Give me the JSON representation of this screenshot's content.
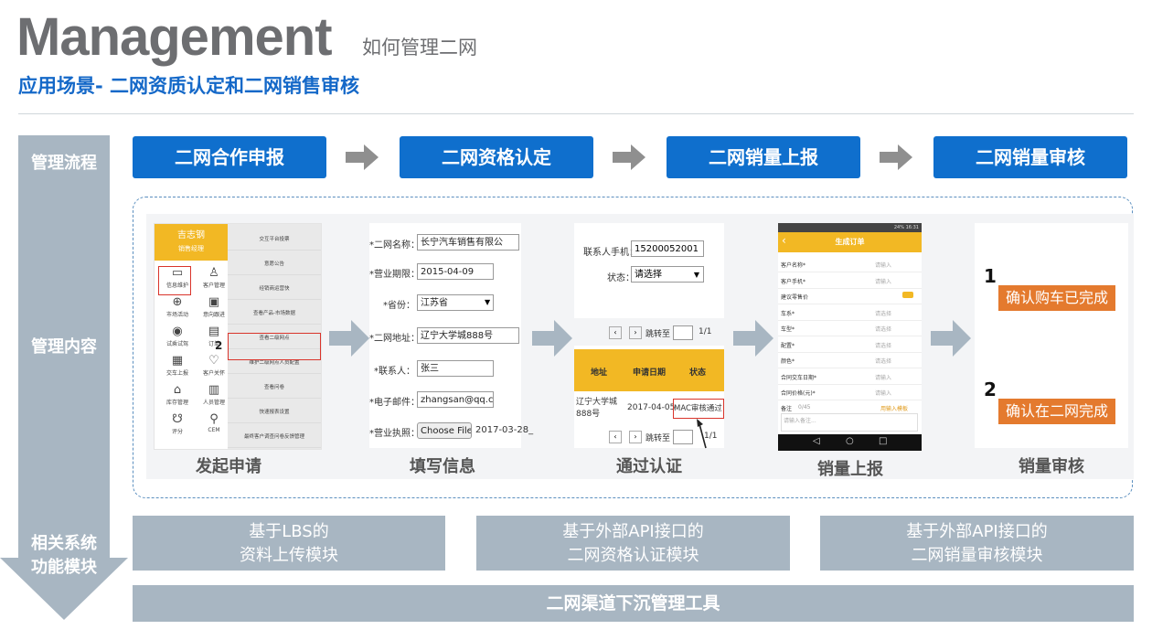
{
  "header": {
    "title": "Management",
    "title_sub": "如何管理二网",
    "subtitle": "应用场景- 二网资质认定和二网销售审核"
  },
  "left_labels": {
    "process": "管理流程",
    "content": "管理内容",
    "system": "相关系统\n功能模块"
  },
  "steps": [
    "二网合作申报",
    "二网资格认定",
    "二网销量上报",
    "二网销量审核"
  ],
  "captions": [
    "发起申请",
    "填写信息",
    "通过认证",
    "销量上报",
    "销量审核"
  ],
  "panel1": {
    "user_name": "吉志钢",
    "user_role": "销售经理",
    "marker": "2",
    "grid": [
      {
        "icon": "monitor-icon",
        "glyph": "▭",
        "label": "信息维护"
      },
      {
        "icon": "user-icon",
        "glyph": "♙",
        "label": "客户管理"
      },
      {
        "icon": "globe-icon",
        "glyph": "⊕",
        "label": "市场活动"
      },
      {
        "icon": "card-icon",
        "glyph": "▣",
        "label": "意向跟进"
      },
      {
        "icon": "car-icon",
        "glyph": "◉",
        "label": "试乘试驾"
      },
      {
        "icon": "order-icon",
        "glyph": "▤",
        "label": "订单"
      },
      {
        "icon": "delivery-icon",
        "glyph": "▦",
        "label": "交车上报"
      },
      {
        "icon": "heart-icon",
        "glyph": "♡",
        "label": "客户关怀"
      },
      {
        "icon": "warehouse-icon",
        "glyph": "⌂",
        "label": "库存管理"
      },
      {
        "icon": "staff-icon",
        "glyph": "▥",
        "label": "人员管理"
      },
      {
        "icon": "rating-icon",
        "glyph": "☋",
        "label": "评分"
      },
      {
        "icon": "cem-icon",
        "glyph": "⚲",
        "label": "CEM"
      }
    ],
    "menu": [
      "交互平台投票",
      "意愿公告",
      "经销商运营快",
      "查看产品-市场数据",
      "查看二级网点",
      "维护二级网点人员配置",
      "查看问卷",
      "快速报表设置",
      "最终客户调查问卷反馈管理"
    ]
  },
  "panel2": {
    "fields": [
      {
        "label": "*二网名称：",
        "value": "长宁汽车销售有限公"
      },
      {
        "label": "*营业期限：",
        "value": "2015-04-09"
      },
      {
        "label": "*省份：",
        "value": "江苏省"
      },
      {
        "label": "*二网地址：",
        "value": "辽宁大学城888号"
      },
      {
        "label": "*联系人：",
        "value": "张三"
      },
      {
        "label": "*电子邮件：",
        "value": "zhangsan@qq.com"
      },
      {
        "label": "*营业执照：",
        "value": "Choose File",
        "extra": "2017-03-28_"
      }
    ]
  },
  "panel3": {
    "phone_label": "联系人手机：",
    "phone_value": "15200052001",
    "status_label": "状态：",
    "status_value": "请选择",
    "pager_label": "跳转至",
    "pager_total": "1/1",
    "col_address": "地址",
    "col_date": "申请日期",
    "col_status": "状态",
    "row_address": "辽宁大学城888号",
    "row_date": "2017-04-05",
    "row_status": "MAC审核通过"
  },
  "panel4": {
    "status_bar": "24%  16:31",
    "title": "生成订单",
    "back": "‹",
    "rows": [
      {
        "label": "客户名称*",
        "value": "请输入"
      },
      {
        "label": "客户手机*",
        "value": "请输入"
      },
      {
        "label": "建议零售价",
        "value": ""
      },
      {
        "label": "车系*",
        "value": "请选择"
      },
      {
        "label": "车型*",
        "value": "请选择"
      },
      {
        "label": "配置*",
        "value": "请选择"
      },
      {
        "label": "颜色*",
        "value": "请选择"
      },
      {
        "label": "合同交车日期*",
        "value": "请输入"
      },
      {
        "label": "合同价格(元)*",
        "value": "请输入"
      }
    ],
    "remark_label": "备注",
    "remark_count": "0/45",
    "remark_template": "用输入模板",
    "remark_placeholder": "请输入备注..."
  },
  "panel5": {
    "items": [
      {
        "num": "1",
        "label": "确认购车已完成"
      },
      {
        "num": "2",
        "label": "确认在二网完成"
      }
    ]
  },
  "systems": [
    "基于LBS的\n资料上传模块",
    "基于外部API接口的\n二网资格认证模块",
    "基于外部API接口的\n二网销量审核模块"
  ],
  "bottom_bar": "二网渠道下沉管理工具",
  "colors": {
    "accent_blue": "#0f6fcd",
    "gray_blue": "#a8b6c2",
    "orange": "#e47a2e",
    "yellow": "#f2b824",
    "highlight_red": "#d9342b"
  }
}
